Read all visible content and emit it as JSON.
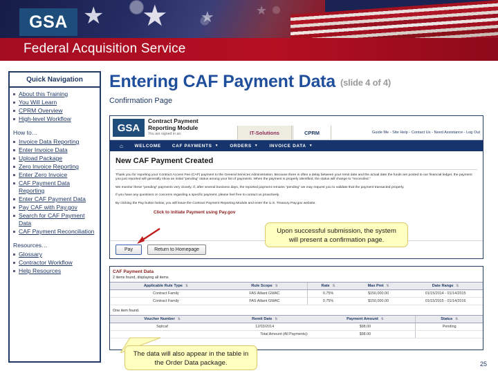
{
  "banner": {
    "agency_logo": "GSA",
    "service_title": "Federal Acquisition Service"
  },
  "quick_nav": {
    "heading": "Quick Navigation",
    "primary_items": [
      "About this Training",
      "You Will Learn",
      "CPRM Overview",
      "High-level Workflow"
    ],
    "howto_label": "How to…",
    "howto_items": [
      "Invoice Data Reporting",
      "Enter Invoice Data",
      "Upload Package",
      "Zero Invoice Reporting",
      "Enter Zero Invoice",
      "CAF Payment Data Reporting",
      "Enter CAF Payment Data",
      "Pay CAF with Pay.gov",
      "Search for CAF Payment Data",
      "CAF Payment Reconciliation"
    ],
    "resources_label": "Resources…",
    "resources_items": [
      "Glossary",
      "Contractor Workflow",
      "Help Resources"
    ]
  },
  "slide": {
    "title": "Entering CAF Payment Data",
    "counter": "(slide 4 of 4)",
    "subtitle": "Confirmation Page",
    "number": "25"
  },
  "app": {
    "logo": "GSA",
    "title_line1": "Contract Payment",
    "title_line2": "Reporting Module",
    "signed_in": "You are signed in as:",
    "tab_selected": "IT-Solutions",
    "tab_alt": "CPRM",
    "utility_links": "Guide Me - Site Help - Contact Us - Need Assistance - Log Out",
    "menu": [
      {
        "label": "WELCOME",
        "caret": false
      },
      {
        "label": "CAF PAYMENTS",
        "caret": true
      },
      {
        "label": "ORDERS",
        "caret": true
      },
      {
        "label": "INVOICE DATA",
        "caret": true
      }
    ],
    "home_icon": "⌂",
    "page_heading": "New CAF Payment Created",
    "paragraphs": [
      "Thank you for reporting your Contract Access Fee (CAF) payment to the General Services Administration. Because there is often a delay between your remit date and the actual date the funds are posted to our financial ledger, the payment you just reported will generally show an initial “pending” status among your list of payments. When the payment is properly identified, the status will change to “reconciled.”",
      "We monitor these “pending” payments very closely. If, after several business days, the reported payment remains “pending” we may request you to validate that the payment transacted properly.",
      "If you have any questions or concerns regarding a specific payment, please feel free to contact us proactively.",
      "By clicking the Pay button below, you will leave the Contract Payment Reporting Module and enter the U.S. Treasury Pay.gov website."
    ],
    "red_hint": "Click to initiate Payment using Pay.gov",
    "buttons": {
      "pay": "Pay",
      "return": "Return to Homepage"
    }
  },
  "caf_payment_data": {
    "section_label": "CAF Payment Data",
    "found_text": "2 items found, displaying all items",
    "columns": [
      "Applicable Rule Type",
      "Rule Scope",
      "Rate",
      "Max Pmt",
      "Date Range"
    ],
    "rows": [
      [
        "Contract Family",
        "FAS Alliant GWAC",
        "0.75%",
        "$150,000.00",
        "01/15/2014 - 01/14/2015"
      ],
      [
        "Contract Family",
        "FAS Alliant GWAC",
        "0.75%",
        "$150,000.00",
        "01/15/2015 - 01/14/2016"
      ]
    ]
  },
  "voucher_table": {
    "found_text": "One item found.",
    "columns": [
      "Voucher Number",
      "Remit Date",
      "Payment Amount",
      "Status"
    ],
    "rows": [
      [
        "Sqlrcaf",
        "12/03/2014",
        "$98.00",
        "Pending"
      ]
    ],
    "total_label": "Total Amount (All Payments):",
    "total_value": "$98.00"
  },
  "callouts": [
    "Upon successful submission, the system will present a confirmation page.",
    "The data will also appear in the table in the Order Data package."
  ],
  "colors": {
    "fas_red": "#a50d23",
    "gsa_blue": "#1e4d7b",
    "title_blue": "#1f4e9c",
    "nav_blue": "#1f3864",
    "callout_yellow": "#ffffbf",
    "hint_red": "#8a1a1a"
  }
}
